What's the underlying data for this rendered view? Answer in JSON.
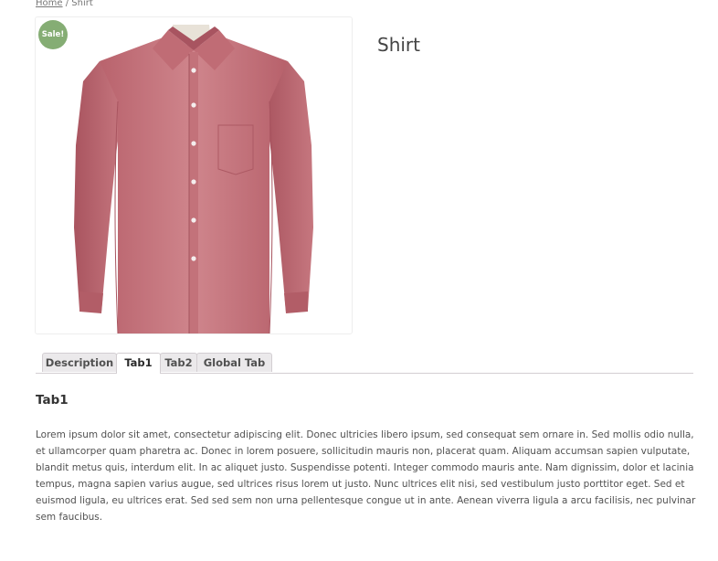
{
  "breadcrumb": {
    "home": "Home",
    "separator": " / ",
    "current": "Shirt"
  },
  "product": {
    "title": "Shirt",
    "sale_badge": "Sale!",
    "image_subject": "pink long-sleeve button-up shirt"
  },
  "tabs": [
    {
      "label": "Description",
      "active": false
    },
    {
      "label": "Tab1",
      "active": true
    },
    {
      "label": "Tab2",
      "active": false
    },
    {
      "label": "Global Tab",
      "active": false
    }
  ],
  "panel": {
    "heading": "Tab1",
    "body": "Lorem ipsum dolor sit amet, consectetur adipiscing elit. Donec ultricies libero ipsum, sed consequat sem ornare in. Sed mollis odio nulla, et ullamcorper quam pharetra ac. Donec in lorem posuere, sollicitudin mauris non, placerat quam. Aliquam accumsan sapien vulputate, blandit metus quis, interdum elit. In ac aliquet justo. Suspendisse potenti. Integer commodo mauris ante. Nam dignissim, dolor et lacinia tempus, magna sapien varius augue, sed ultrices risus lorem ut justo. Nunc ultrices elit nisi, sed vestibulum justo porttitor eget. Sed et euismod ligula, eu ultrices erat. Sed sed sem non urna pellentesque congue ut in ante. Aenean viverra ligula a arcu facilisis, nec pulvinar sem faucibus."
  },
  "colors": {
    "sale_badge": "#85ad74",
    "shirt": "#c97a82",
    "tab_inactive_bg": "#ebe9eb",
    "tab_border": "#d3ced2"
  }
}
